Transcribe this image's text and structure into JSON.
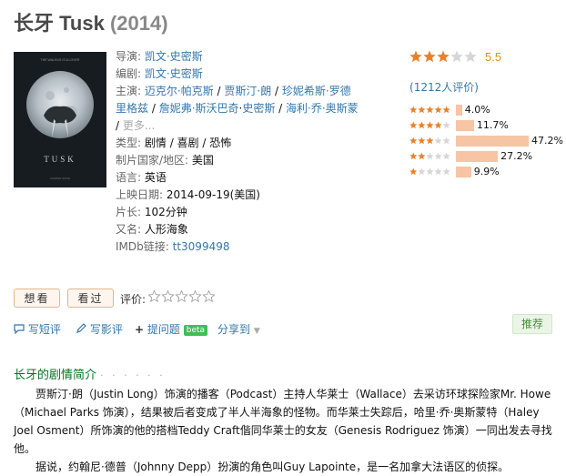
{
  "header": {
    "title": "长牙 Tusk",
    "year": "(2014)"
  },
  "poster": {
    "top_caption": "THE WALRUS IS A LOVER",
    "title": "TUSK",
    "bottom_caption": "COMING SOON"
  },
  "info": {
    "director_label": "导演:",
    "director": "凯文·史密斯",
    "writer_label": "编剧:",
    "writer": "凯文·史密斯",
    "cast_label": "主演:",
    "cast": [
      "迈克尔·帕克斯",
      "贾斯汀·朗",
      "珍妮希斯·罗德里格兹",
      "詹妮弗·斯沃巴奇",
      "史密斯",
      "海利·乔·奥斯蒙"
    ],
    "cast_more": "更多...",
    "genre_label": "类型:",
    "genre": "剧情 / 喜剧 / 恐怖",
    "country_label": "制片国家/地区:",
    "country": "美国",
    "language_label": "语言:",
    "language": "英语",
    "release_label": "上映日期:",
    "release": "2014-09-19(美国)",
    "runtime_label": "片长:",
    "runtime": "102分钟",
    "aka_label": "又名:",
    "aka": "人形海象",
    "imdb_label": "IMDb链接:",
    "imdb": "tt3099498"
  },
  "rating": {
    "stars": 3,
    "score": "5.5",
    "votes_prefix": "(",
    "votes_count": "1212",
    "votes_suffix": "人评价)",
    "distribution": [
      {
        "stars": 5,
        "percent": 4.0,
        "label": "4.0%"
      },
      {
        "stars": 4,
        "percent": 11.7,
        "label": "11.7%"
      },
      {
        "stars": 3,
        "percent": 47.2,
        "label": "47.2%"
      },
      {
        "stars": 2,
        "percent": 27.2,
        "label": "27.2%"
      },
      {
        "stars": 1,
        "percent": 9.9,
        "label": "9.9%"
      }
    ]
  },
  "actions": {
    "want_label": "想看",
    "seen_label": "看过",
    "rate_label": "评价:",
    "short_review": "写短评",
    "review": "写影评",
    "ask": "提问题",
    "beta": "beta",
    "share": "分享到",
    "recommend": "推荐"
  },
  "colors": {
    "link": "#3377aa",
    "star": "#e8812b",
    "bar": "#f7c4a4",
    "section": "#007722"
  },
  "summary": {
    "title": "长牙的剧情简介",
    "dots": "· · · · · ·",
    "p1": "贾斯汀·朗（Justin Long）饰演的播客（Podcast）主持人华莱士（Wallace）去采访环球探险家Mr. Howe（Michael Parks 饰演），结果被后者变成了半人半海象的怪物。而华莱士失踪后，哈里·乔·奥斯蒙特（Haley Joel Osment）所饰演的他的搭档Teddy Craft偕同华莱士的女友（Genesis Rodriguez 饰演）一同出发去寻找他。",
    "p2": "据说，约翰尼·德普（Johnny Depp）扮演的角色叫Guy Lapointe，是一名加拿大法语区的侦探。"
  }
}
